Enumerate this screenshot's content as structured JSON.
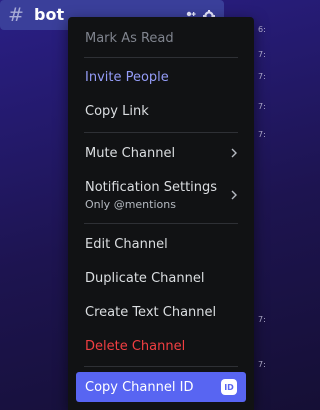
{
  "channel": {
    "hash_glyph": "#",
    "name": "bot",
    "icons": [
      "add-member-icon",
      "gear-icon"
    ]
  },
  "background": {
    "timestamps": [
      "6:",
      "7:",
      "7:",
      "7:",
      "7:",
      "7:",
      "7:"
    ]
  },
  "context_menu": {
    "mark_as_read": "Mark As Read",
    "invite_people": "Invite People",
    "copy_link": "Copy Link",
    "mute_channel": "Mute Channel",
    "notification_settings": "Notification Settings",
    "notification_settings_sub": "Only @mentions",
    "edit_channel": "Edit Channel",
    "duplicate_channel": "Duplicate Channel",
    "create_text_channel": "Create Text Channel",
    "delete_channel": "Delete Channel",
    "copy_channel_id": "Copy Channel ID",
    "id_badge": "ID"
  },
  "colors": {
    "accent": "#949cf7",
    "danger": "#f23f42",
    "highlight": "#5865f2",
    "menu_bg": "#111214",
    "channel_selected": "#3a3f9a"
  }
}
